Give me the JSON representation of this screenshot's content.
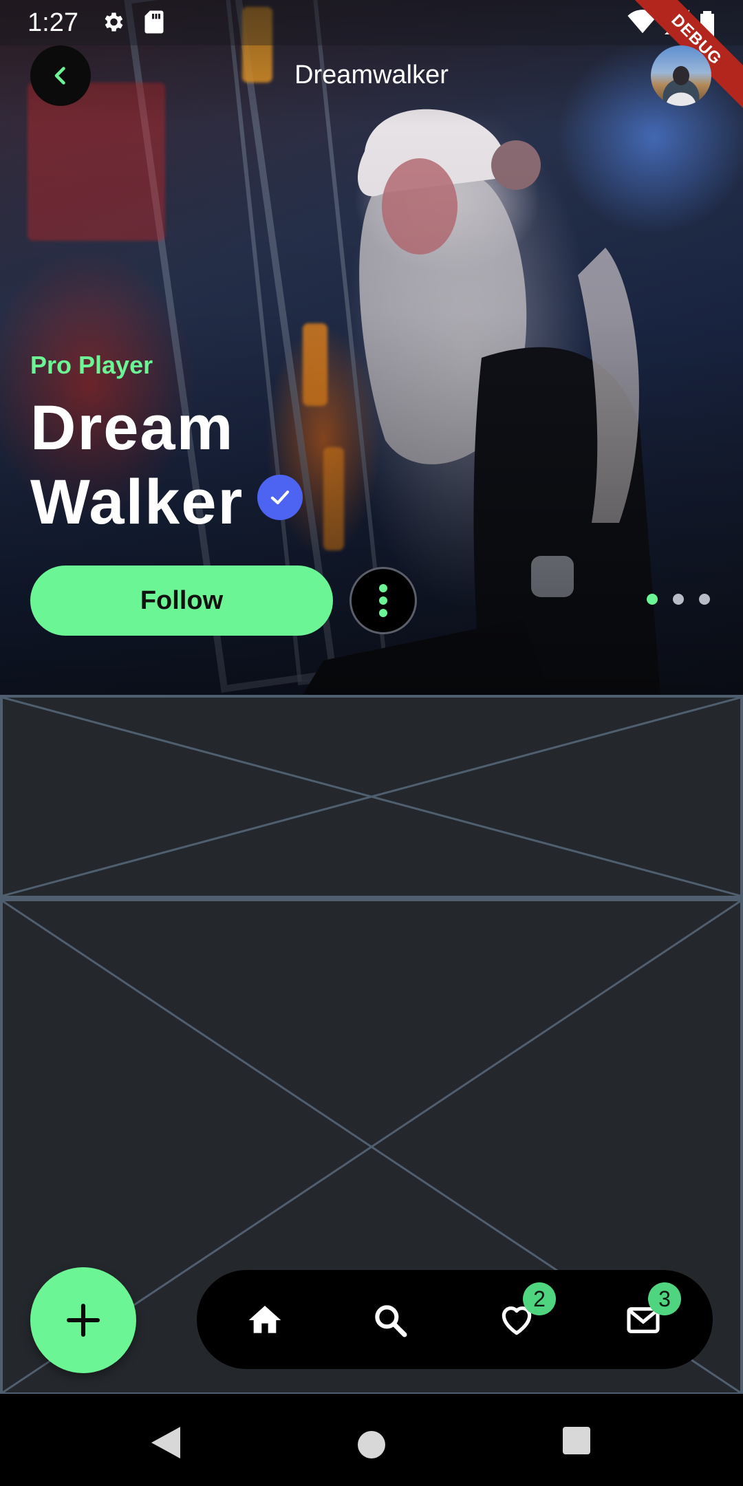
{
  "status_bar": {
    "time": "1:27",
    "debug_label": "DEBUG"
  },
  "app_bar": {
    "title": "Dreamwalker"
  },
  "hero": {
    "subtitle": "Pro Player",
    "name_line1": "Dream",
    "name_line2": "Walker",
    "follow_label": "Follow",
    "carousel": {
      "count": 3,
      "active_index": 0
    }
  },
  "bottom_nav": {
    "items": [
      {
        "icon": "home-icon"
      },
      {
        "icon": "search-icon"
      },
      {
        "icon": "heart-icon",
        "badge": "2"
      },
      {
        "icon": "mail-icon",
        "badge": "3"
      }
    ]
  },
  "colors": {
    "accent": "#6cf595",
    "verified": "#4d63f2",
    "background": "#24272c",
    "placeholder_stroke": "#4f5f6f"
  }
}
